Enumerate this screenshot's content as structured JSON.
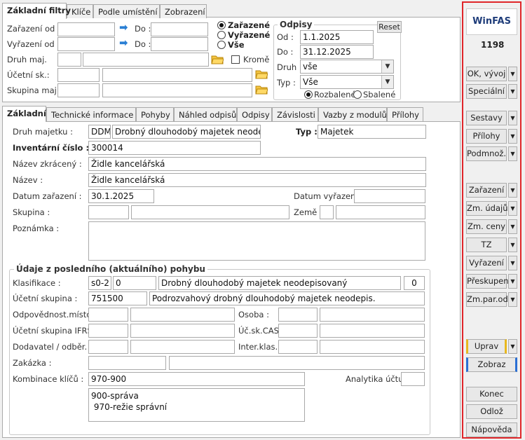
{
  "top_tabs": [
    "Základní filtry",
    "Klíče",
    "Podle umístění",
    "Zobrazení"
  ],
  "filters": {
    "zarazeni_od": "Zařazení od :",
    "vyrazeni_od": "Vyřazení od :",
    "do1": "Do :",
    "do2": "Do :",
    "druh_maj": "Druh maj.",
    "krome": "Kromě",
    "ucetni_sk": "Účetní sk.:",
    "skupina_maj": "Skupina maj. :",
    "radio_zarazene": "Zařazené",
    "radio_vyrazene": "Vyřazené",
    "radio_vse": "Vše"
  },
  "odpisy": {
    "title": "Odpisy",
    "reset": "Reset",
    "od_label": "Od :",
    "od_value": "1.1.2025",
    "do_label": "Do :",
    "do_value": "31.12.2025",
    "druh_label": "Druh :",
    "druh_value": "vše",
    "typ_label": "Typ :",
    "typ_value": "Vše",
    "rozbalene": "Rozbalené",
    "sbalene": "Sbalené"
  },
  "detail_tabs": [
    "Základní",
    "Technické informace",
    "Pohyby",
    "Náhled odpisů",
    "Odpisy",
    "Závislosti",
    "Vazby z modulů",
    "Přílohy"
  ],
  "detail": {
    "druh_majetku_label": "Druh majetku :",
    "druh_kod": "DDM",
    "druh_nazev": "Drobný dlouhodobý majetek neodepis",
    "typ_label": "Typ :",
    "typ_value": "Majetek",
    "inv_cislo_label": "Inventární číslo :",
    "inv_cislo": "300014",
    "nazev_zkr_label": "Název zkrácený :",
    "nazev_zkr": "Židle kancelářská",
    "nazev_label": "Název :",
    "nazev": "Židle kancelářská",
    "datum_zar_label": "Datum zařazení :",
    "datum_zar": "30.1.2025",
    "datum_vyr_label": "Datum vyřazení :",
    "skupina_label": "Skupina :",
    "zeme_label": "Země :",
    "poznamka_label": "Poznámka :"
  },
  "pohyb": {
    "title": "Údaje z posledního (aktuálního) pohybu",
    "klasifikace_label": "Klasifikace :",
    "klas_kod": "s0-2",
    "klas_num": "0",
    "klas_nazev": "Drobný dlouhodobý majetek neodepisovaný",
    "klas_cislo": "0",
    "ucetni_skupina_label": "Účetní skupina :",
    "ucetni_skupina": "751500",
    "ucetni_skupina_nazev": "Podrozvahový drobný dlouhodobý majetek neodepis.",
    "odpovednost_label": "Odpovědnost.místo :",
    "osoba_label": "Osoba :",
    "ucetni_ifrs_label": "Účetní skupina IFRS :",
    "uc_sk_cas_label": "Úč.sk.CAS :",
    "dodavatel_label": "Dodavatel / odběr. :",
    "inter_klas_label": "Inter.klas. :",
    "zakazka_label": "Zakázka :",
    "kombinace_label": "Kombinace klíčů :",
    "kombinace": "970-900",
    "analytika_label": "Analytika účtu :",
    "kombinace_popis_1": "900-správa",
    "kombinace_popis_2": " 970-režie správní"
  },
  "sidebar": {
    "logo": "WinFAS",
    "count": "1198",
    "buttons": {
      "ok": "OK, vývoj",
      "specialni": "Speciální",
      "sestavy": "Sestavy",
      "prilohy": "Přílohy",
      "podmnoz": "Podmnož.",
      "zarazeni": "Zařazení",
      "zm_udaju": "Zm. údajů",
      "zm_ceny": "Zm. ceny",
      "tz": "TZ",
      "vyrazeni": "Vyřazení",
      "preskupeni": "Přeskupení",
      "zm_par_odp": "Zm.par.odp",
      "uprav": "Uprav",
      "zobraz": "Zobraz",
      "konec": "Konec",
      "odloz": "Odlož",
      "napoveda": "Nápověda"
    }
  }
}
